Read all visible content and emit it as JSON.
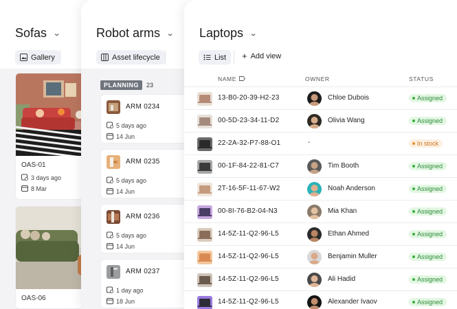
{
  "sofas": {
    "title": "Sofas",
    "view_label": "Gallery",
    "cards": [
      {
        "name": "OAS-01",
        "ago": "3 days ago",
        "date": "8 Mar"
      },
      {
        "name": "OAS-06"
      }
    ]
  },
  "robots": {
    "title": "Robot arms",
    "view_label": "Asset lifecycle",
    "column": {
      "label": "PLANNING",
      "count": "23"
    },
    "cards": [
      {
        "name": "ARM 0234",
        "ago": "5 days ago",
        "date": "14 Jun"
      },
      {
        "name": "ARM 0235",
        "ago": "5 days ago",
        "date": "14 Jun"
      },
      {
        "name": "ARM 0236",
        "ago": "5 days ago",
        "date": "14 Jun"
      },
      {
        "name": "ARM 0237",
        "ago": "1 day ago",
        "date": "18 Jun"
      }
    ]
  },
  "laptops": {
    "title": "Laptops",
    "view_label": "List",
    "add_view_label": "Add view",
    "headers": {
      "name": "NAME",
      "owner": "OWNER",
      "status": "STATUS"
    },
    "rows": [
      {
        "name": "13-B0-20-39-H2-23",
        "owner": "Chloe Dubois",
        "status": "Assigned"
      },
      {
        "name": "00-5D-23-34-11-D2",
        "owner": "Olivia Wang",
        "status": "Assigned"
      },
      {
        "name": "22-2A-32-P7-88-O1",
        "owner": "-",
        "status": "In stock"
      },
      {
        "name": "00-1F-84-22-81-C7",
        "owner": "Tim Booth",
        "status": "Assigned"
      },
      {
        "name": "2T-16-5F-11-67-W2",
        "owner": "Noah Anderson",
        "status": "Assigned"
      },
      {
        "name": "00-8I-76-B2-04-N3",
        "owner": "Mia Khan",
        "status": "Assigned"
      },
      {
        "name": "14-5Z-11-Q2-96-L5",
        "owner": "Ethan Ahmed",
        "status": "Assigned"
      },
      {
        "name": "14-5Z-11-Q2-96-L5",
        "owner": "Benjamin Muller",
        "status": "Assigned"
      },
      {
        "name": "14-5Z-11-Q2-96-L5",
        "owner": "Ali Hadid",
        "status": "Assigned"
      },
      {
        "name": "14-5Z-11-Q2-96-L5",
        "owner": "Alexander Ivaov",
        "status": "Assigned"
      }
    ]
  },
  "colors": {
    "assigned_bg": "#e3f7e3",
    "assigned_fg": "#2e8b3a",
    "assigned_dot": "#3cb043",
    "instock_bg": "#fdf0e0",
    "instock_fg": "#c9731f",
    "instock_dot": "#e8912f"
  }
}
